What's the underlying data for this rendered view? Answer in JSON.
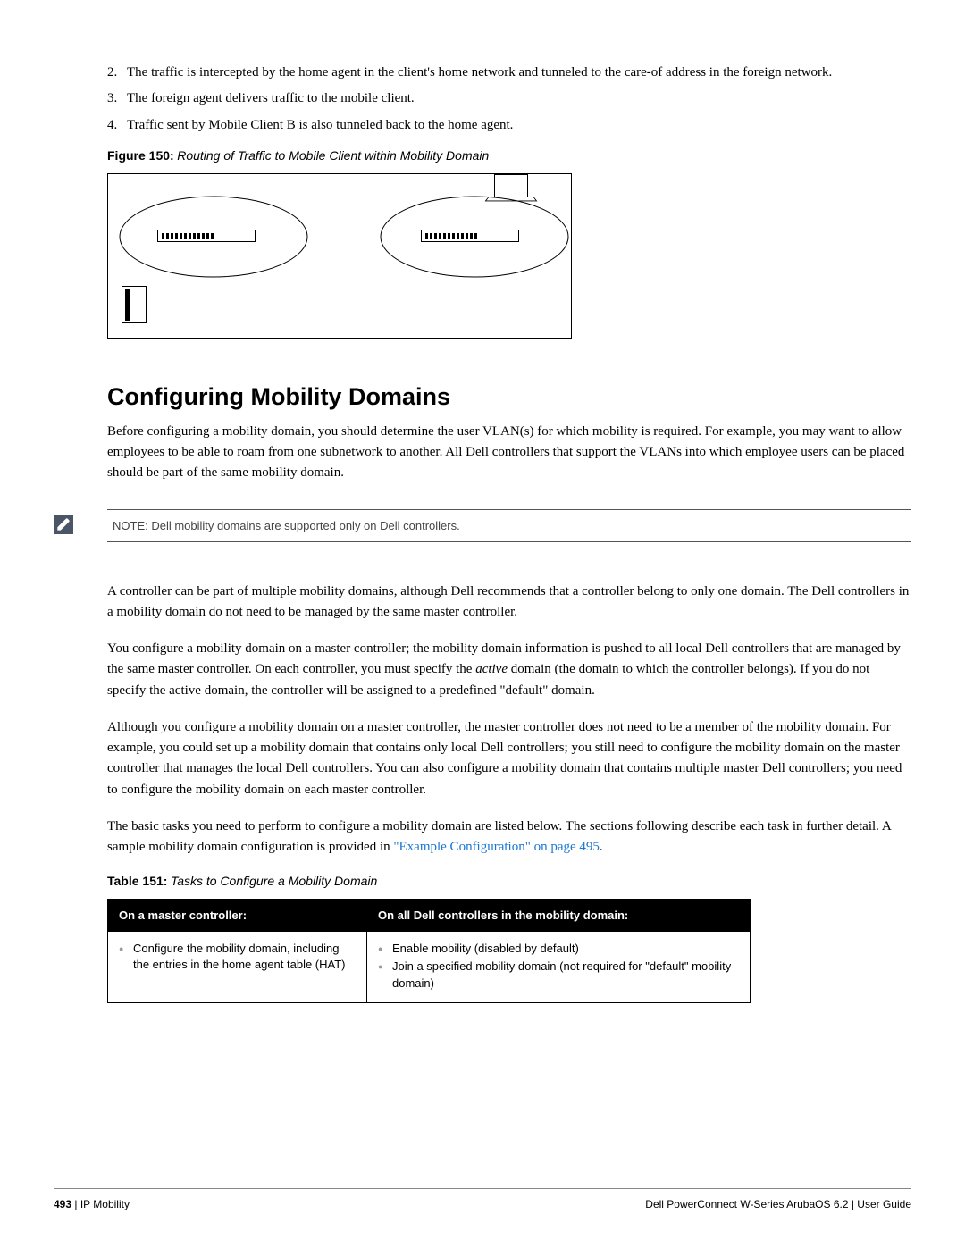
{
  "list": {
    "item2": {
      "num": "2.",
      "text": "The traffic is intercepted by the home agent in the client's home network and tunneled to the care-of address in the foreign network."
    },
    "item3": {
      "num": "3.",
      "text": "The foreign agent delivers traffic to the mobile client."
    },
    "item4": {
      "num": "4.",
      "text": "Traffic sent by Mobile Client B is also tunneled back to the home agent."
    }
  },
  "figure": {
    "label": "Figure 150:",
    "title": "Routing of Traffic to Mobile Client within Mobility Domain"
  },
  "heading": "Configuring Mobility Domains",
  "para1": "Before configuring a mobility domain, you should determine the user VLAN(s) for which mobility is required. For example, you may want to allow employees to be able to roam from one subnetwork to another. All Dell controllers that support the VLANs into which employee users can be placed should be part of the same mobility domain.",
  "note": "NOTE: Dell mobility domains are supported only on  Dell controllers.",
  "para2": "A controller can be part of multiple mobility domains, although Dell recommends that a controller belong to only one domain. The Dell controllers in a mobility domain do not need to be managed by the same master controller.",
  "para3a": "You configure a mobility domain on a master controller; the mobility domain information is pushed to all local Dell controllers that are managed by the same master controller. On each controller, you must specify the ",
  "para3_em": "active",
  "para3b": " domain (the domain to which the controller belongs). If you do not specify the active domain, the controller will be assigned to a predefined \"default\" domain.",
  "para4": "Although you configure a mobility domain on a master controller, the master controller does not need to be a member of the mobility domain. For example, you could set up a mobility domain that contains only local Dell controllers; you still need to configure the mobility domain on the master controller that manages the local Dell controllers. You can also configure a mobility domain that contains multiple master Dell controllers; you need to configure the mobility domain on each master controller.",
  "para5a": "The basic tasks you need to perform to configure a mobility domain are listed below. The sections following describe each task in further detail. A sample mobility domain configuration is provided in ",
  "para5_link": "\"Example Configuration\" on page 495",
  "para5b": ".",
  "table": {
    "label": "Table 151:",
    "title": "Tasks to Configure a Mobility Domain",
    "header1": "On a master controller:",
    "header2": "On all Dell controllers in the mobility domain:",
    "col1_item1": "Configure the mobility domain, including the entries in the home agent table (HAT)",
    "col2_item1": "Enable mobility (disabled by default)",
    "col2_item2": "Join a specified mobility domain (not required for \"default\" mobility domain)"
  },
  "footer": {
    "page": "493",
    "section": "IP Mobility",
    "product": "Dell PowerConnect W-Series ArubaOS 6.2",
    "doc": "User Guide"
  }
}
